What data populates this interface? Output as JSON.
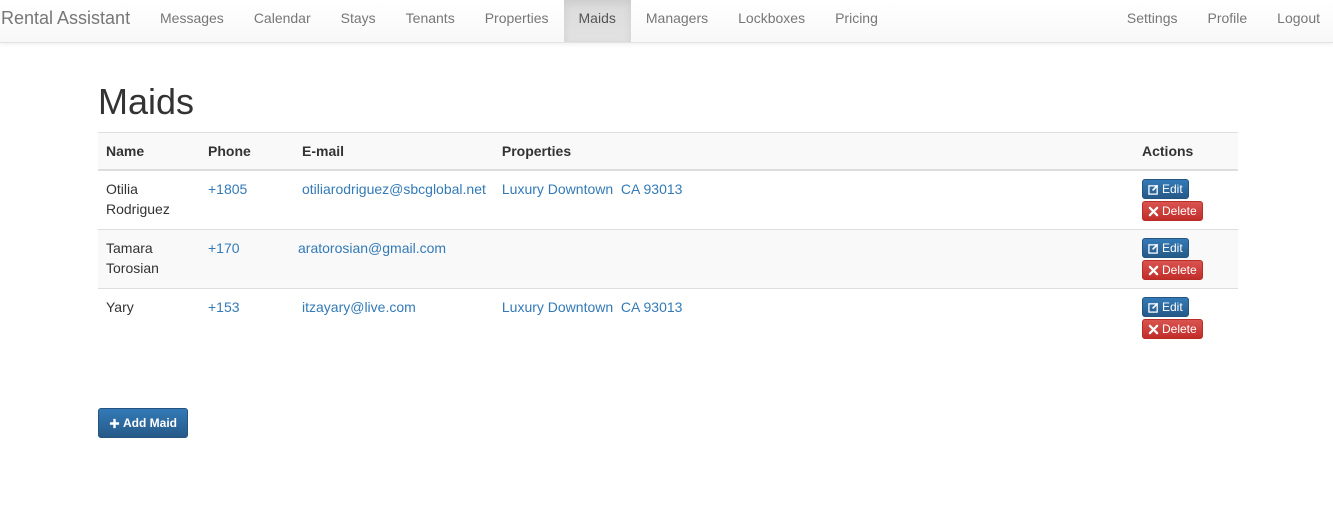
{
  "brand": "Rental Assistant",
  "nav_left": [
    {
      "label": "Messages"
    },
    {
      "label": "Calendar"
    },
    {
      "label": "Stays"
    },
    {
      "label": "Tenants"
    },
    {
      "label": "Properties"
    },
    {
      "label": "Maids",
      "active": true
    },
    {
      "label": "Managers"
    },
    {
      "label": "Lockboxes"
    },
    {
      "label": "Pricing"
    }
  ],
  "nav_right": [
    {
      "label": "Settings"
    },
    {
      "label": "Profile"
    },
    {
      "label": "Logout"
    }
  ],
  "page_title": "Maids",
  "table": {
    "headers": {
      "name": "Name",
      "phone": "Phone",
      "email": "E-mail",
      "properties": "Properties",
      "actions": "Actions"
    },
    "rows": [
      {
        "name": "Otilia Rodriguez",
        "phone": "+1805",
        "email": "otiliarodriguez@sbcglobal.net",
        "properties": "Luxury Downtown  CA 93013"
      },
      {
        "name": "Tamara Torosian",
        "phone": "+170",
        "email": "aratorosian@gmail.com",
        "properties": ""
      },
      {
        "name": "Yary",
        "phone": "+153",
        "email": "itzayary@live.com",
        "properties": "Luxury Downtown  CA 93013"
      }
    ],
    "edit_label": "Edit",
    "delete_label": "Delete"
  },
  "add_button_label": "Add Maid",
  "colors": {
    "link": "#337ab7",
    "primary": "#337ab7",
    "danger": "#d9534f"
  }
}
